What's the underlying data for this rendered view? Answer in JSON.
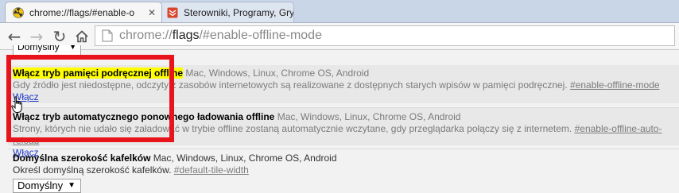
{
  "tabs": [
    {
      "title": "chrome://flags/#enable-o",
      "icon": "radiation-icon",
      "active": true
    },
    {
      "title": "Sterowniki, Programy, Gry",
      "icon": "shield-icon",
      "active": false
    }
  ],
  "toolbar": {
    "url_scheme": "chrome://",
    "url_host": "flags",
    "url_rest": "/#enable-offline-mode"
  },
  "top_select": {
    "value": "Domyślny"
  },
  "experiments": [
    {
      "name": "Włącz tryb pamięci podręcznej offline",
      "platforms": "Mac, Windows, Linux, Chrome OS, Android",
      "description": "Gdy źródło jest niedostępne, odczyty z zasobów internetowych są realizowane z dostępnych starych wpisów w pamięci podręcznej.",
      "hash": "#enable-offline-mode",
      "action": "Włącz"
    },
    {
      "name": "Włącz tryb automatycznego ponownego ładowania offline",
      "platforms": "Mac, Windows, Linux, Chrome OS, Android",
      "description": "Strony, których nie udało się załadować w trybie offline zostaną automatycznie wczytane, gdy przeglądarka połączy się z internetem.",
      "hash": "#enable-offline-auto-reload",
      "action": "Włącz"
    },
    {
      "name": "Domyślna szerokość kafelków",
      "platforms": "Mac, Windows, Linux, Chrome OS, Android",
      "description": "Określ domyślną szerokość kafelków.",
      "hash": "#default-tile-width",
      "select_value": "Domyślny"
    }
  ],
  "colors": {
    "highlight_box": "#e8141b",
    "marker": "#ffff00",
    "link": "#1b35c6"
  }
}
